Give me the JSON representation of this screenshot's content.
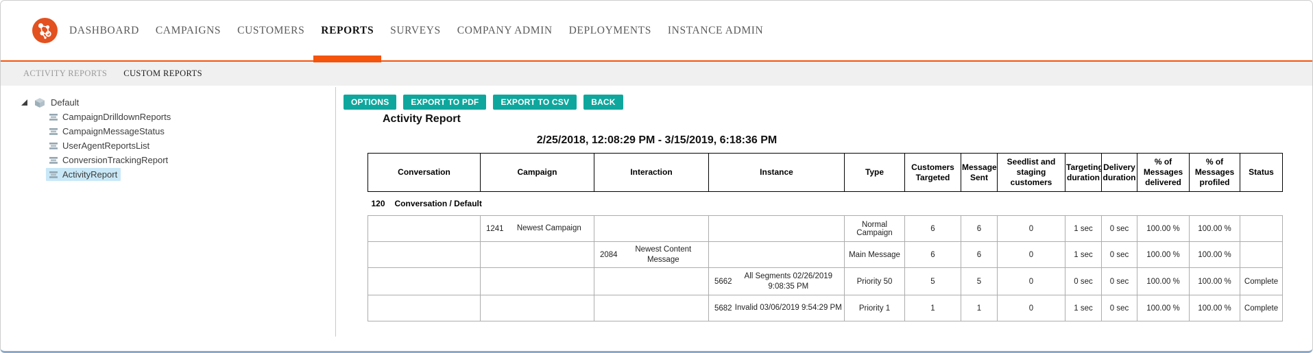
{
  "brand": {
    "accent_orange": "#f4540c",
    "button_teal": "#0fa79d",
    "tree_highlight_blue": "#c9e8f7",
    "logo_icon": "network-nodes-logo"
  },
  "nav": {
    "items": [
      {
        "label": "DASHBOARD",
        "active": false
      },
      {
        "label": "CAMPAIGNS",
        "active": false
      },
      {
        "label": "CUSTOMERS",
        "active": false
      },
      {
        "label": "REPORTS",
        "active": true
      },
      {
        "label": "SURVEYS",
        "active": false
      },
      {
        "label": "COMPANY ADMIN",
        "active": false
      },
      {
        "label": "DEPLOYMENTS",
        "active": false
      },
      {
        "label": "INSTANCE ADMIN",
        "active": false
      }
    ]
  },
  "subnav": {
    "items": [
      {
        "label": "ACTIVITY REPORTS",
        "active": false
      },
      {
        "label": "CUSTOM REPORTS",
        "active": true
      }
    ]
  },
  "tree": {
    "root": {
      "label": "Default",
      "icon": "cube-icon",
      "state_icon": "expanded-triangle"
    },
    "items": [
      {
        "label": "CampaignDrilldownReports",
        "icon": "report-stack-icon",
        "selected": false
      },
      {
        "label": "CampaignMessageStatus",
        "icon": "report-stack-icon",
        "selected": false
      },
      {
        "label": "UserAgentReportsList",
        "icon": "report-stack-icon",
        "selected": false
      },
      {
        "label": "ConversionTrackingReport",
        "icon": "report-stack-icon",
        "selected": false
      },
      {
        "label": "ActivityReport",
        "icon": "report-stack-icon",
        "selected": true
      }
    ]
  },
  "toolbar": {
    "buttons": [
      {
        "label": "OPTIONS"
      },
      {
        "label": "EXPORT TO PDF"
      },
      {
        "label": "EXPORT TO CSV"
      },
      {
        "label": "BACK"
      }
    ]
  },
  "report": {
    "title": "Activity Report",
    "date_range": "2/25/2018, 12:08:29 PM  -  3/15/2019, 6:18:36 PM"
  },
  "table": {
    "columns": [
      "Conversation",
      "Campaign",
      "Interaction",
      "Instance",
      "Type",
      "Customers Targeted",
      "Messages Sent",
      "Seedlist and staging customers",
      "Targeting duration",
      "Delivery duration",
      "% of Messages delivered",
      "% of Messages profiled",
      "Status"
    ],
    "group_row": {
      "id": "120",
      "label": "Conversation / Default"
    },
    "rows": [
      {
        "campaign_id": "1241",
        "campaign_name": "Newest Campaign",
        "interaction_id": "",
        "interaction_name": "",
        "instance_id": "",
        "instance_name": "",
        "type": "Normal Campaign",
        "customers_targeted": "6",
        "messages_sent": "6",
        "seedlist_staging": "0",
        "targeting_duration": "1 sec",
        "delivery_duration": "0 sec",
        "pct_delivered": "100.00 %",
        "pct_profiled": "100.00 %",
        "status": ""
      },
      {
        "campaign_id": "",
        "campaign_name": "",
        "interaction_id": "2084",
        "interaction_name": "Newest Content Message",
        "instance_id": "",
        "instance_name": "",
        "type": "Main Message",
        "customers_targeted": "6",
        "messages_sent": "6",
        "seedlist_staging": "0",
        "targeting_duration": "1 sec",
        "delivery_duration": "0 sec",
        "pct_delivered": "100.00 %",
        "pct_profiled": "100.00 %",
        "status": ""
      },
      {
        "campaign_id": "",
        "campaign_name": "",
        "interaction_id": "",
        "interaction_name": "",
        "instance_id": "5662",
        "instance_name": "All Segments 02/26/2019 9:08:35 PM",
        "type": "Priority 50",
        "customers_targeted": "5",
        "messages_sent": "5",
        "seedlist_staging": "0",
        "targeting_duration": "0 sec",
        "delivery_duration": "0 sec",
        "pct_delivered": "100.00 %",
        "pct_profiled": "100.00 %",
        "status": "Complete"
      },
      {
        "campaign_id": "",
        "campaign_name": "",
        "interaction_id": "",
        "interaction_name": "",
        "instance_id": "5682",
        "instance_name": "Invalid 03/06/2019 9:54:29 PM",
        "type": "Priority 1",
        "customers_targeted": "1",
        "messages_sent": "1",
        "seedlist_staging": "0",
        "targeting_duration": "1 sec",
        "delivery_duration": "0 sec",
        "pct_delivered": "100.00 %",
        "pct_profiled": "100.00 %",
        "status": "Complete"
      }
    ]
  }
}
